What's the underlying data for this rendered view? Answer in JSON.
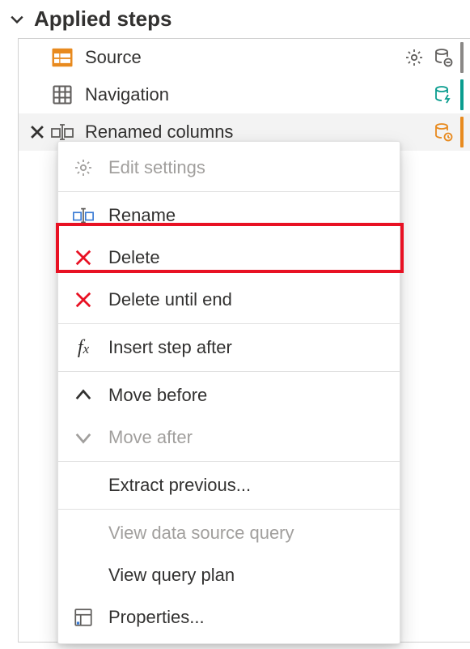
{
  "header": {
    "title": "Applied steps"
  },
  "steps": [
    {
      "label": "Source",
      "status_stripe": "#8a8886"
    },
    {
      "label": "Navigation",
      "status_stripe": "#0a9d8f"
    },
    {
      "label": "Renamed columns",
      "status_stripe": "#e88a1e"
    }
  ],
  "menu": {
    "items": [
      {
        "label": "Edit settings",
        "icon": "gear-icon",
        "disabled": true
      },
      {
        "sep": true
      },
      {
        "label": "Rename",
        "icon": "rename-icon"
      },
      {
        "label": "Delete",
        "icon": "delete-x-icon",
        "highlighted": true
      },
      {
        "label": "Delete until end",
        "icon": "delete-x-icon"
      },
      {
        "sep": true
      },
      {
        "label": "Insert step after",
        "icon": "fx-icon"
      },
      {
        "sep": true
      },
      {
        "label": "Move before",
        "icon": "chevron-up-icon"
      },
      {
        "label": "Move after",
        "icon": "chevron-down-icon",
        "disabled": true
      },
      {
        "sep": true
      },
      {
        "label": "Extract previous..."
      },
      {
        "sep": true
      },
      {
        "label": "View data source query",
        "disabled": true
      },
      {
        "label": "View query plan"
      },
      {
        "label": "Properties...",
        "icon": "properties-icon"
      }
    ]
  },
  "colors": {
    "accent_red": "#e81123",
    "source_icon": "#e88a1e",
    "teal": "#0a9d8f"
  }
}
